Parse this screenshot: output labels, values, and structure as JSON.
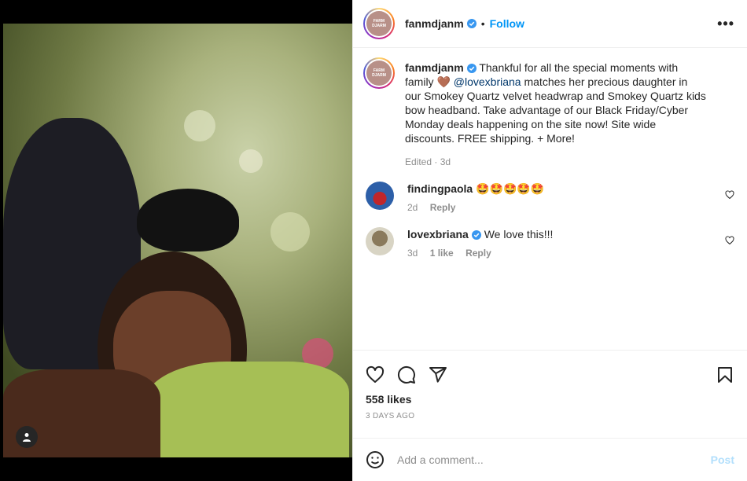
{
  "post": {
    "author": "fanmdjanm",
    "avatar_text": "FARM DJARM",
    "follow_label": "Follow",
    "dot": "•",
    "more_label": "•••",
    "icons": [
      "more-icon",
      "verified-icon",
      "heart-icon",
      "comment-icon",
      "share-icon",
      "bookmark-icon",
      "emoji-icon",
      "user-tag-icon"
    ]
  },
  "caption": {
    "author": "fanmdjanm",
    "text_before": "Thankful for all the special moments with family",
    "emoji": "🤎",
    "mention": "@lovexbriana",
    "text_after": "matches her precious daughter in our Smokey Quartz velvet headwrap and Smokey Quartz kids bow headband. Take advantage of our Black Friday/Cyber Monday deals happening on the site now! Site wide discounts. FREE shipping. + More!",
    "meta": "Edited · 3d"
  },
  "comments": [
    {
      "user": "findingpaola",
      "text": "🤩🤩🤩🤩🤩",
      "time": "2d",
      "likes": "",
      "reply": "Reply",
      "verified": false
    },
    {
      "user": "lovexbriana",
      "text": "We love this!!!",
      "time": "3d",
      "likes": "1 like",
      "reply": "Reply",
      "verified": true
    }
  ],
  "footer": {
    "likes": "558 likes",
    "date": "3 DAYS AGO",
    "comment_placeholder": "Add a comment...",
    "post_label": "Post"
  },
  "colors": {
    "link": "#0095f6",
    "mention": "#00376b",
    "muted": "#8e8e8e",
    "post_disabled": "#b2dffc"
  }
}
